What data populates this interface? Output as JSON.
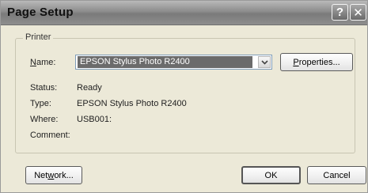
{
  "window": {
    "title": "Page Setup",
    "help_glyph": "?",
    "close_glyph": "✕"
  },
  "printer_group": {
    "label": "Printer",
    "name_label_accel": "N",
    "name_label_rest": "ame:",
    "name_value": "EPSON Stylus Photo R2400",
    "properties_accel": "P",
    "properties_rest": "roperties...",
    "status_label": "Status:",
    "status_value": "Ready",
    "type_label": "Type:",
    "type_value": "EPSON Stylus Photo R2400",
    "where_label": "Where:",
    "where_value": "USB001:",
    "comment_label": "Comment:",
    "comment_value": ""
  },
  "footer": {
    "network_prefix": "Net",
    "network_accel": "w",
    "network_rest": "ork...",
    "ok_label": "OK",
    "cancel_label": "Cancel"
  },
  "icons": {
    "combo_arrow": "chevron-down-icon",
    "help": "help-icon",
    "close": "close-icon"
  }
}
